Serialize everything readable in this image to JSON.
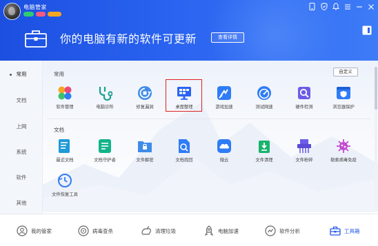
{
  "header": {
    "app_title": "电脑管家",
    "badges": [
      "",
      "",
      " "
    ],
    "update_text": "你的电脑有新的软件可更新",
    "detail_button": "查看详情"
  },
  "nav": {
    "items": [
      {
        "label": "常用",
        "active": true
      },
      {
        "label": "文档",
        "active": false
      },
      {
        "label": "上网",
        "active": false
      },
      {
        "label": "系统",
        "active": false
      },
      {
        "label": "软件",
        "active": false
      },
      {
        "label": "其他",
        "active": false
      }
    ]
  },
  "content": {
    "custom_button": "自定义",
    "sections": [
      {
        "title": "常用",
        "tools": [
          {
            "label": "软件管理",
            "icon": "software-manager-icon"
          },
          {
            "label": "电脑诊所",
            "icon": "pc-clinic-icon"
          },
          {
            "label": "修复漏洞",
            "icon": "fix-vulnerability-icon"
          },
          {
            "label": "桌面整理",
            "icon": "desktop-organize-icon"
          },
          {
            "label": "游戏加速",
            "icon": "game-boost-icon"
          },
          {
            "label": "测试网速",
            "icon": "speed-test-icon"
          },
          {
            "label": "硬件检测",
            "icon": "hardware-check-icon"
          },
          {
            "label": "浏览器保护",
            "icon": "browser-protect-icon"
          }
        ]
      },
      {
        "title": "文档",
        "tools": [
          {
            "label": "最近文档",
            "icon": "recent-docs-icon"
          },
          {
            "label": "文档守护者",
            "icon": "doc-guardian-icon"
          },
          {
            "label": "文件解密",
            "icon": "file-decrypt-icon"
          },
          {
            "label": "文档找回",
            "icon": "doc-recover-icon"
          },
          {
            "label": "微云",
            "icon": "weiyun-icon"
          },
          {
            "label": "文件清理",
            "icon": "file-clean-icon"
          },
          {
            "label": "文件粉碎",
            "icon": "file-shred-icon"
          },
          {
            "label": "勒索病毒免疫",
            "icon": "ransomware-immune-icon"
          },
          {
            "label": "文件恢复工具",
            "icon": "file-restore-icon"
          }
        ]
      }
    ]
  },
  "bottombar": {
    "items": [
      {
        "label": "我的管家",
        "icon": "my-manager-icon",
        "active": false
      },
      {
        "label": "病毒查杀",
        "icon": "virus-scan-icon",
        "active": false
      },
      {
        "label": "清理垃圾",
        "icon": "clean-junk-icon",
        "active": false
      },
      {
        "label": "电脑加速",
        "icon": "pc-boost-icon",
        "active": false
      },
      {
        "label": "软件分析",
        "icon": "software-analysis-icon",
        "active": false
      },
      {
        "label": "工具箱",
        "icon": "toolbox-icon",
        "active": true
      }
    ]
  },
  "colors": {
    "header_start": "#1c4fe0",
    "header_end": "#3d7bf7",
    "accent": "#1f56e6",
    "highlight_border": "#e02020"
  }
}
